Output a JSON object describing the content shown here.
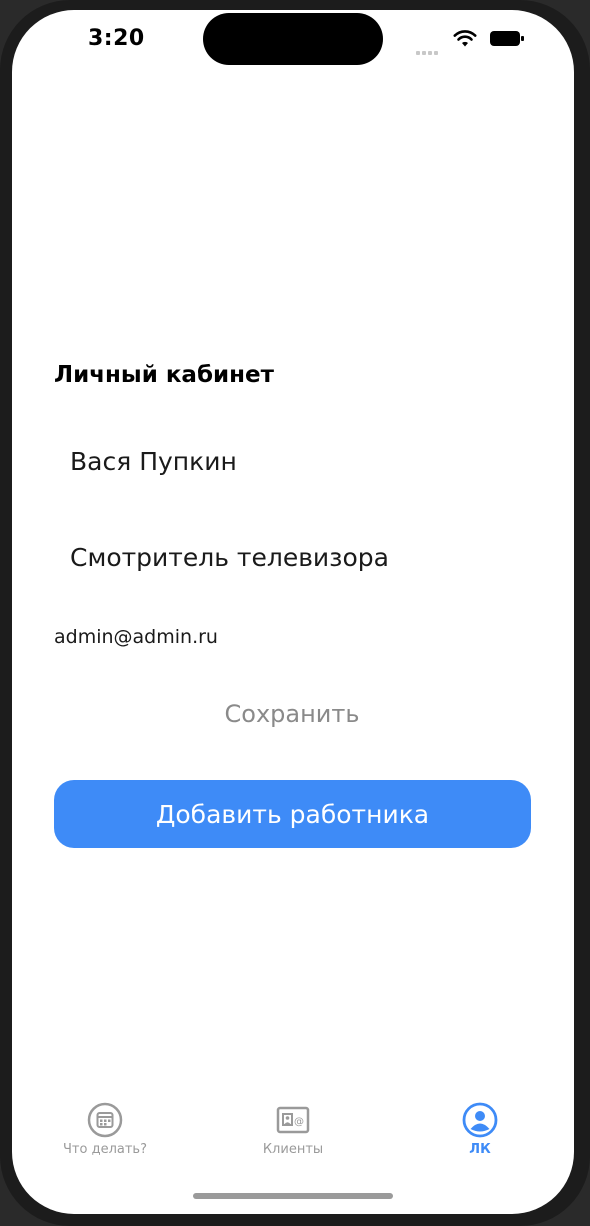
{
  "status_bar": {
    "time": "3:20"
  },
  "page": {
    "title": "Личный кабинет",
    "name_value": "Вася Пупкин",
    "role_value": "Смотритель телевизора",
    "email": "admin@admin.ru",
    "save_label": "Сохранить",
    "add_worker_label": "Добавить работника"
  },
  "tab_bar": {
    "items": [
      {
        "label": "Что делать?",
        "icon": "calendar-icon",
        "active": false
      },
      {
        "label": "Клиенты",
        "icon": "contact-card-icon",
        "active": false
      },
      {
        "label": "ЛК",
        "icon": "person-circle-icon",
        "active": true
      }
    ]
  },
  "colors": {
    "accent": "#3e8bf7",
    "inactive": "#9a9a9a",
    "save_text": "#8a8a8a"
  }
}
